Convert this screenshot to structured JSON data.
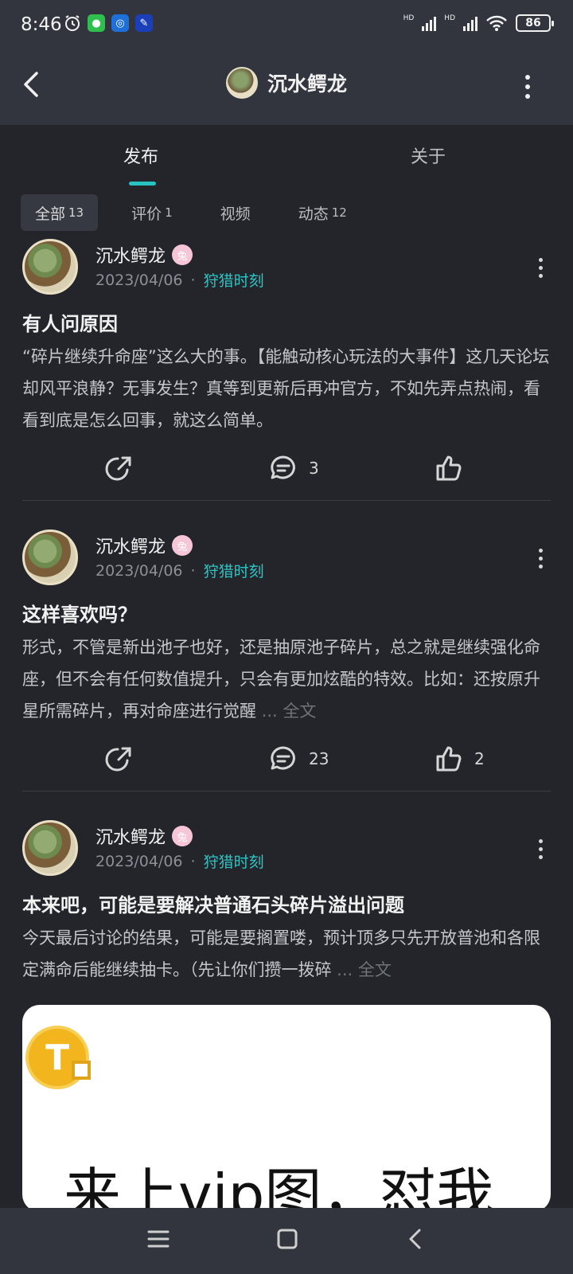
{
  "status": {
    "time": "8:46",
    "battery": "86",
    "network": [
      "HD",
      "HD"
    ]
  },
  "header": {
    "title": "沉水鳄龙",
    "back_icon": "back-arrow-icon",
    "more_icon": "more-vertical-icon"
  },
  "tabs": [
    {
      "label": "发布",
      "active": true
    },
    {
      "label": "关于",
      "active": false
    }
  ],
  "filters": [
    {
      "label": "全部",
      "count": "13",
      "active": true
    },
    {
      "label": "评价",
      "count": "1",
      "active": false
    },
    {
      "label": "视频",
      "count": "",
      "active": false
    },
    {
      "label": "动态",
      "count": "12",
      "active": false
    }
  ],
  "posts": [
    {
      "author": "沉水鳄龙",
      "date": "2023/04/06",
      "topic": "狩猎时刻",
      "title": "有人问原因",
      "body": "“碎片继续升命座”这么大的事。【能触动核心玩法的大事件】这几天论坛却风平浪静？无事发生？真等到更新后再冲官方，不如先弄点热闹，看看到底是怎么回事，就这么简单。",
      "more": "",
      "comments": "3",
      "likes": ""
    },
    {
      "author": "沉水鳄龙",
      "date": "2023/04/06",
      "topic": "狩猎时刻",
      "title": "这样喜欢吗？",
      "body": "形式，不管是新出池子也好，还是抽原池子碎片，总之就是继续强化命座，但不会有任何数值提升，只会有更加炫酷的特效。比如：还按原升星所需碎片，再对命座进行觉醒",
      "more": " ... 全文",
      "comments": "23",
      "likes": "2"
    },
    {
      "author": "沉水鳄龙",
      "date": "2023/04/06",
      "topic": "狩猎时刻",
      "title": "本来吧，可能是要解决普通石头碎片溢出问题",
      "body": "今天最后讨论的结果，可能是要搁置喽，预计顶多只先开放普池和各限定满命后能继续抽卡。（先让你们攒一拨碎",
      "more": " ... 全文",
      "comments": "",
      "likes": ""
    }
  ],
  "image_preview": {
    "coin_letter": "T",
    "text": "来上vip图，怼我"
  },
  "separator": "·",
  "colors": {
    "accent": "#27c2c2",
    "background": "#23252b",
    "header": "#32353e"
  }
}
